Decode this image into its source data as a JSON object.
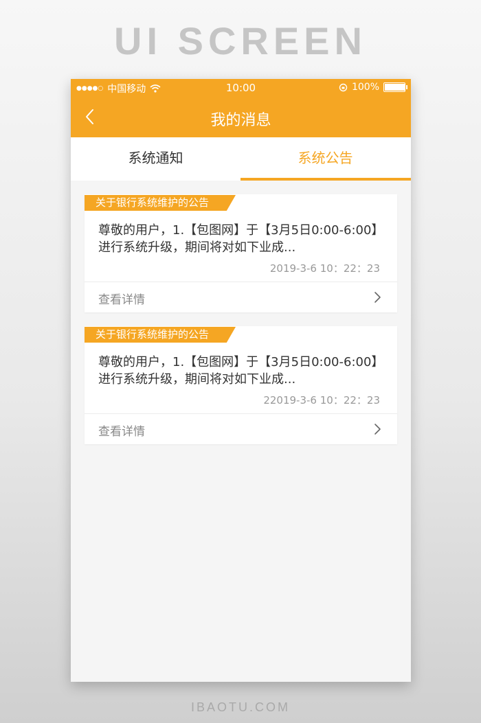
{
  "showcase": {
    "title": "UI SCREEN",
    "footer": "IBAOTU.COM"
  },
  "status_bar": {
    "signal": "●●●●○",
    "carrier": "中国移动",
    "wifi_icon": "wifi-icon",
    "time": "10:00",
    "rotation_lock_icon": "rotation-lock-icon",
    "battery": "100%",
    "battery_icon": "battery-icon"
  },
  "nav": {
    "back_icon": "chevron-left-icon",
    "title": "我的消息"
  },
  "tabs": [
    {
      "label": "系统通知",
      "active": false
    },
    {
      "label": "系统公告",
      "active": true
    }
  ],
  "messages": [
    {
      "tag": "关于银行系统维护的公告",
      "text": "尊敬的用户，1.【包图网】于【3月5日0:00-6:00】进行系统升级，期间将对如下业成...",
      "time": "2019-3-6 10：22：23",
      "more": "查看详情",
      "more_icon": "chevron-right-icon"
    },
    {
      "tag": "关于银行系统维护的公告",
      "text": "尊敬的用户，1.【包图网】于【3月5日0:00-6:00】进行系统升级，期间将对如下业成...",
      "time": "22019-3-6 10：22：23",
      "more": "查看详情",
      "more_icon": "chevron-right-icon"
    }
  ],
  "colors": {
    "accent": "#f5a623",
    "background": "#f5f5f5",
    "text": "#333333",
    "muted": "#999999"
  }
}
